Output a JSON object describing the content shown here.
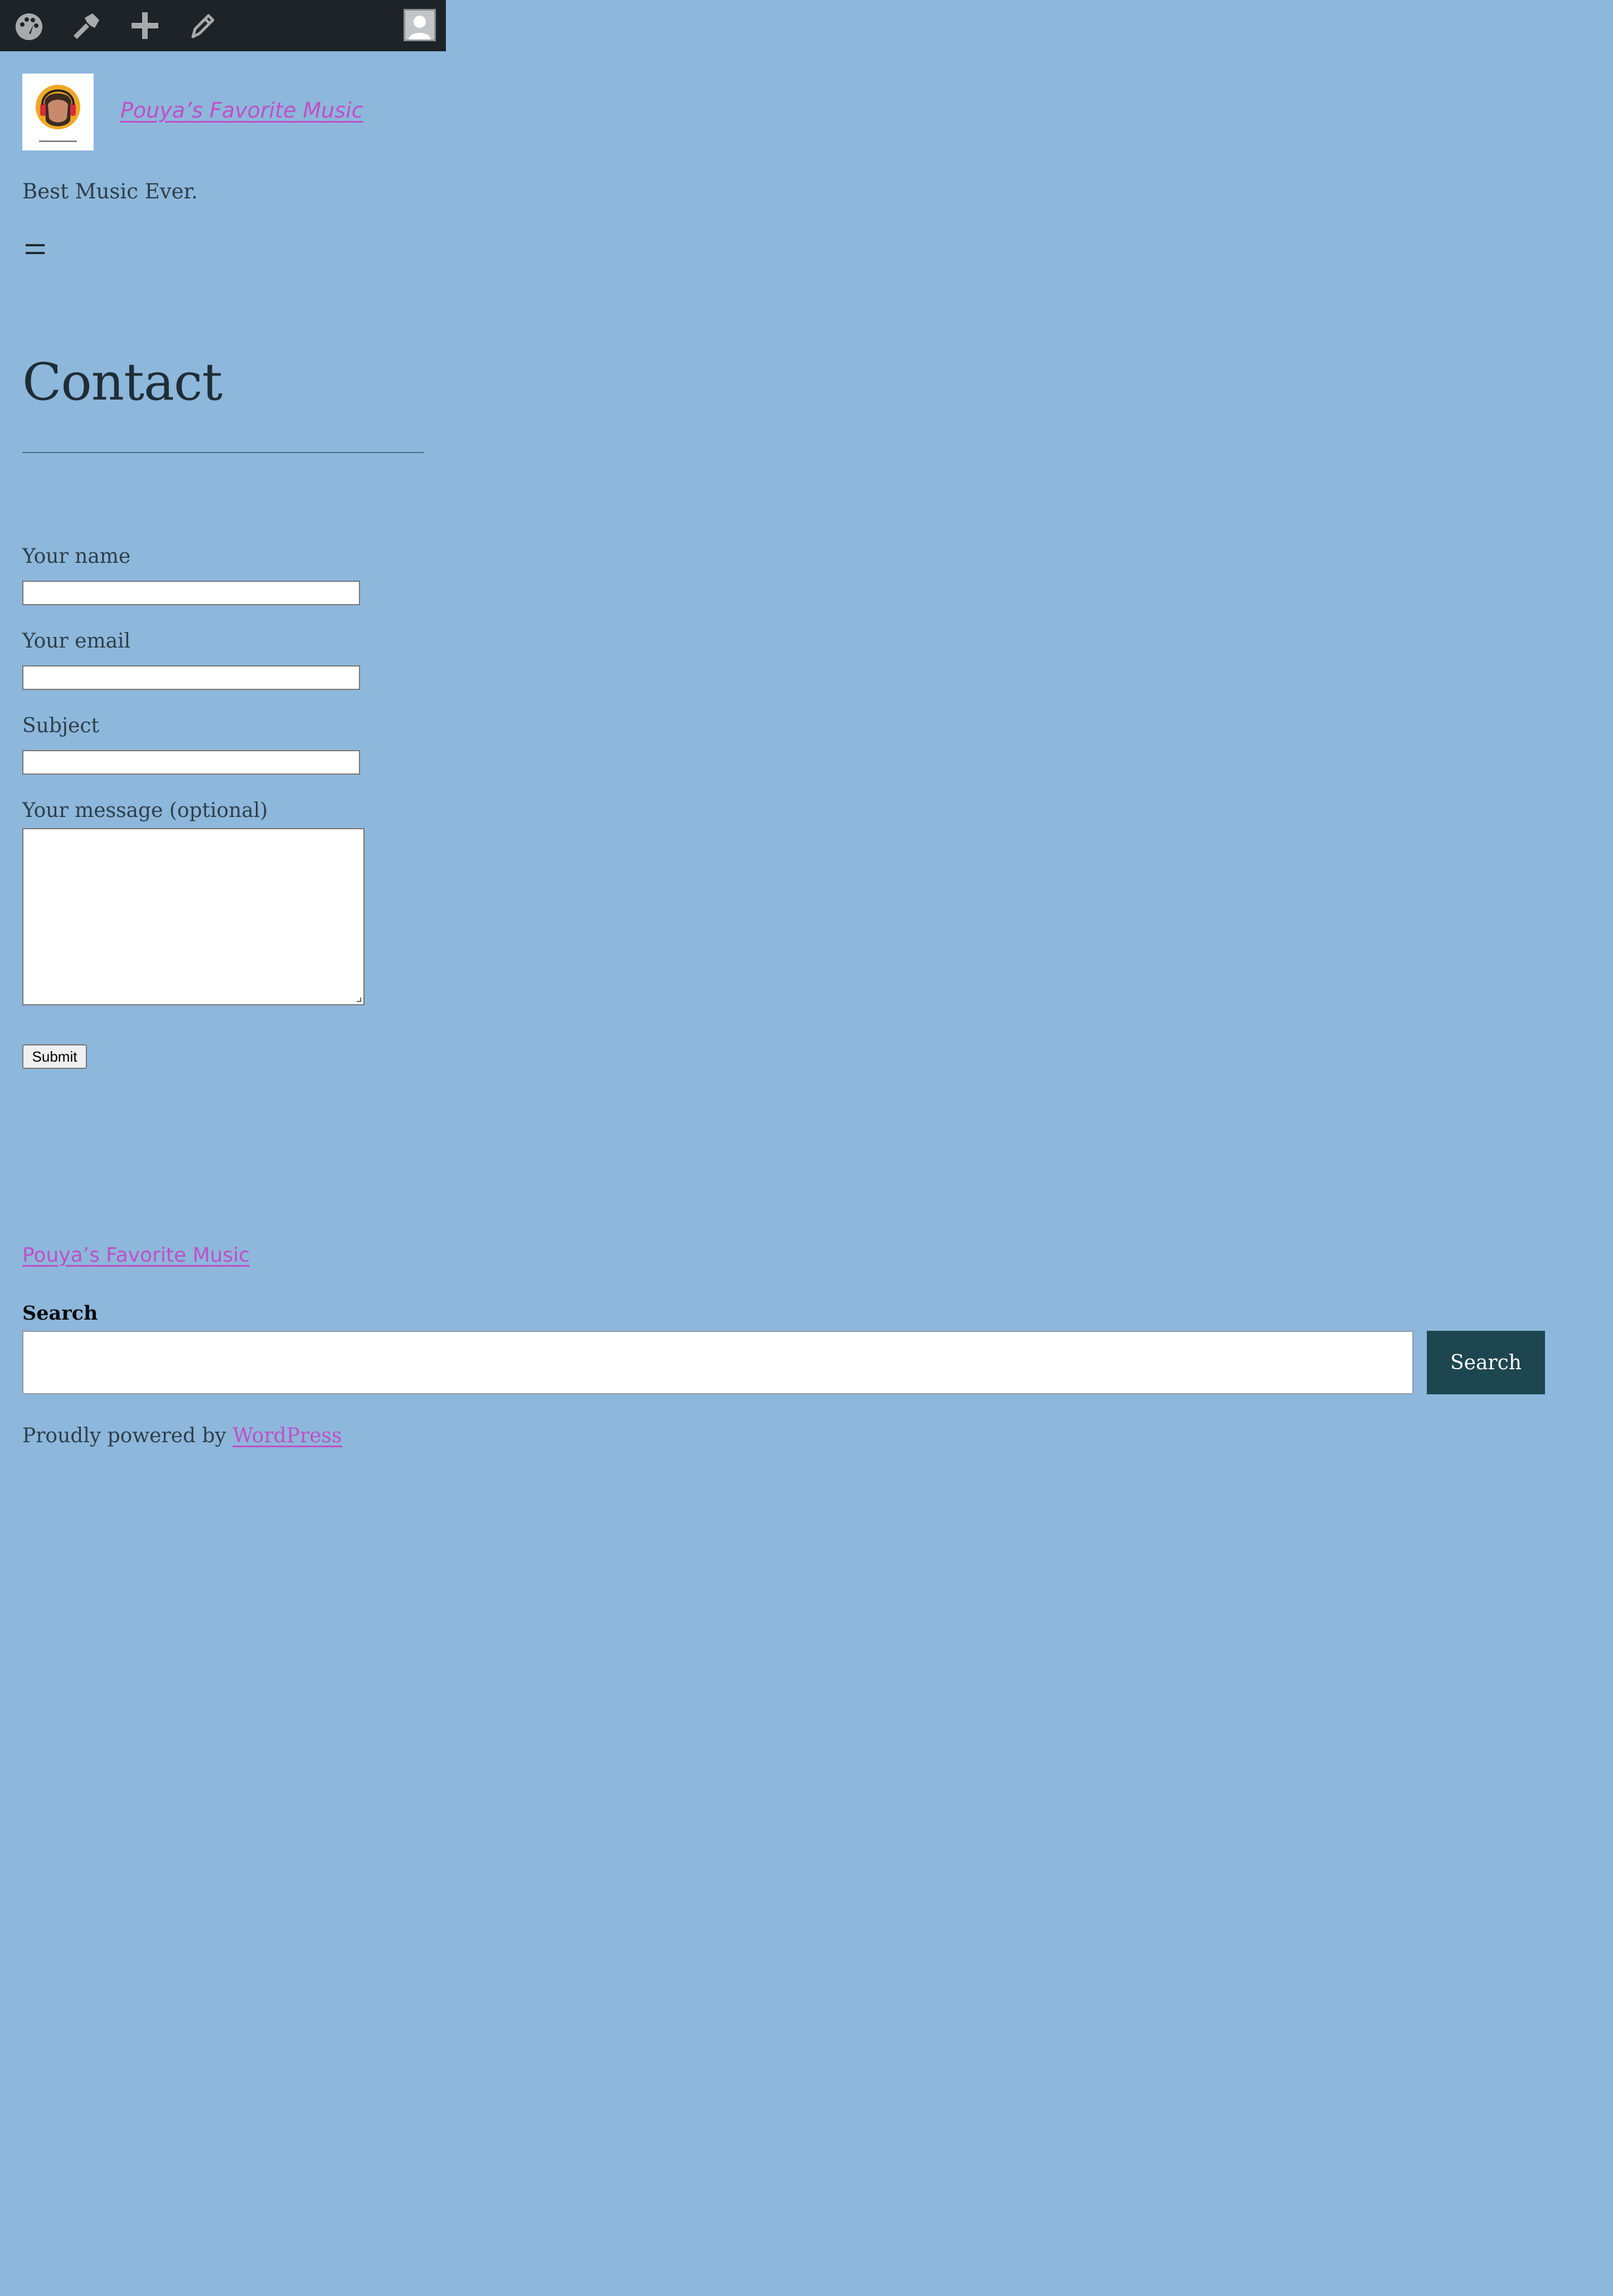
{
  "admin_bar": {
    "icons": [
      "site-icon",
      "customize-icon",
      "new-content-icon",
      "edit-icon"
    ],
    "account_icon": "user-avatar-icon"
  },
  "site": {
    "logo_icon": "music-logo",
    "title": "Pouya’s Favorite Music",
    "tagline": "Best Music Ever."
  },
  "menu_toggle_icon": "menu-toggle-icon",
  "page": {
    "title": "Contact"
  },
  "form": {
    "name_label": "Your name",
    "email_label": "Your email",
    "subject_label": "Subject",
    "message_label": "Your message (optional)",
    "submit_label": "Submit"
  },
  "footer": {
    "site_title": "Pouya’s Favorite Music",
    "search_label": "Search",
    "search_button": "Search",
    "powered_prefix": "Proudly powered by ",
    "powered_link": "WordPress"
  },
  "colors": {
    "background": "#8db7db",
    "admin_bar": "#1d2327",
    "link": "#c04fc9",
    "search_button": "#1e4650"
  }
}
